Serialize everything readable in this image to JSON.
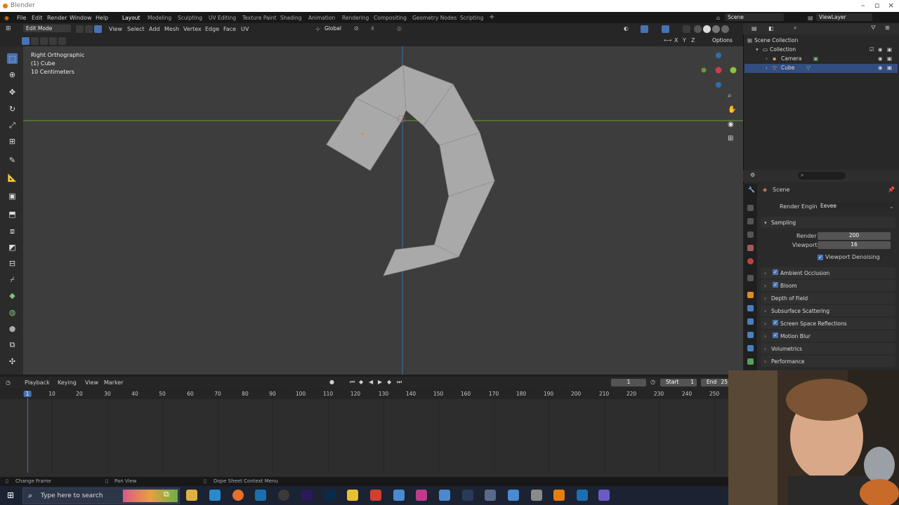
{
  "window": {
    "title": "Blender"
  },
  "menu": {
    "items": [
      "File",
      "Edit",
      "Render",
      "Window",
      "Help"
    ],
    "workspaces": [
      "Layout",
      "Modeling",
      "Sculpting",
      "UV Editing",
      "Texture Paint",
      "Shading",
      "Animation",
      "Rendering",
      "Compositing",
      "Geometry Nodes",
      "Scripting"
    ],
    "active_workspace": "Layout",
    "add_tab": "+",
    "scene": "Scene",
    "view_layer": "ViewLayer"
  },
  "viewport_header": {
    "mode": "Edit Mode",
    "menus": [
      "View",
      "Select",
      "Add",
      "Mesh",
      "Vertex",
      "Edge",
      "Face",
      "UV"
    ],
    "transform_orientation": "Global",
    "options": "Options",
    "axes": [
      "X",
      "Y",
      "Z"
    ]
  },
  "viewport": {
    "view_name": "Right Orthographic",
    "object": "(1) Cube",
    "scale": "10 Centimeters"
  },
  "outliner": {
    "root": "Scene Collection",
    "collection": "Collection",
    "items": [
      "Camera",
      "Cube"
    ]
  },
  "properties": {
    "context": "Scene",
    "render_engine_label": "Render Engine",
    "render_engine": "Eevee",
    "sampling": "Sampling",
    "render_label": "Render",
    "render_samples": "200",
    "viewport_label": "Viewport",
    "viewport_samples": "16",
    "viewport_denoising": "Viewport Denoising",
    "panels": [
      {
        "label": "Ambient Occlusion",
        "checked": true
      },
      {
        "label": "Bloom",
        "checked": true
      },
      {
        "label": "Depth of Field",
        "checked": false
      },
      {
        "label": "Subsurface Scattering",
        "checked": false
      },
      {
        "label": "Screen Space Reflections",
        "checked": true
      },
      {
        "label": "Motion Blur",
        "checked": true
      },
      {
        "label": "Volumetrics",
        "checked": false
      },
      {
        "label": "Performance",
        "checked": false
      }
    ]
  },
  "timeline": {
    "menus": [
      "Playback",
      "Keying",
      "View",
      "Marker"
    ],
    "current_frame": "1",
    "start_label": "Start",
    "start": "1",
    "end_label": "End",
    "end": "25",
    "ticks": [
      "1",
      "10",
      "20",
      "30",
      "40",
      "50",
      "60",
      "70",
      "80",
      "90",
      "100",
      "110",
      "120",
      "130",
      "140",
      "150",
      "160",
      "170",
      "180",
      "190",
      "200",
      "210",
      "220",
      "230",
      "240",
      "250"
    ]
  },
  "statusbar": {
    "items": [
      "Change Frame",
      "Pan View",
      "Dope Sheet Context Menu"
    ]
  },
  "taskbar": {
    "search_placeholder": "Type here to search"
  },
  "colors": {
    "accent": "#4772b3",
    "viewport": "#3d3d3d",
    "mesh": "#a9a9a9",
    "x_axis": "#6a9a2a",
    "y_axis": "#2f6fb0"
  }
}
